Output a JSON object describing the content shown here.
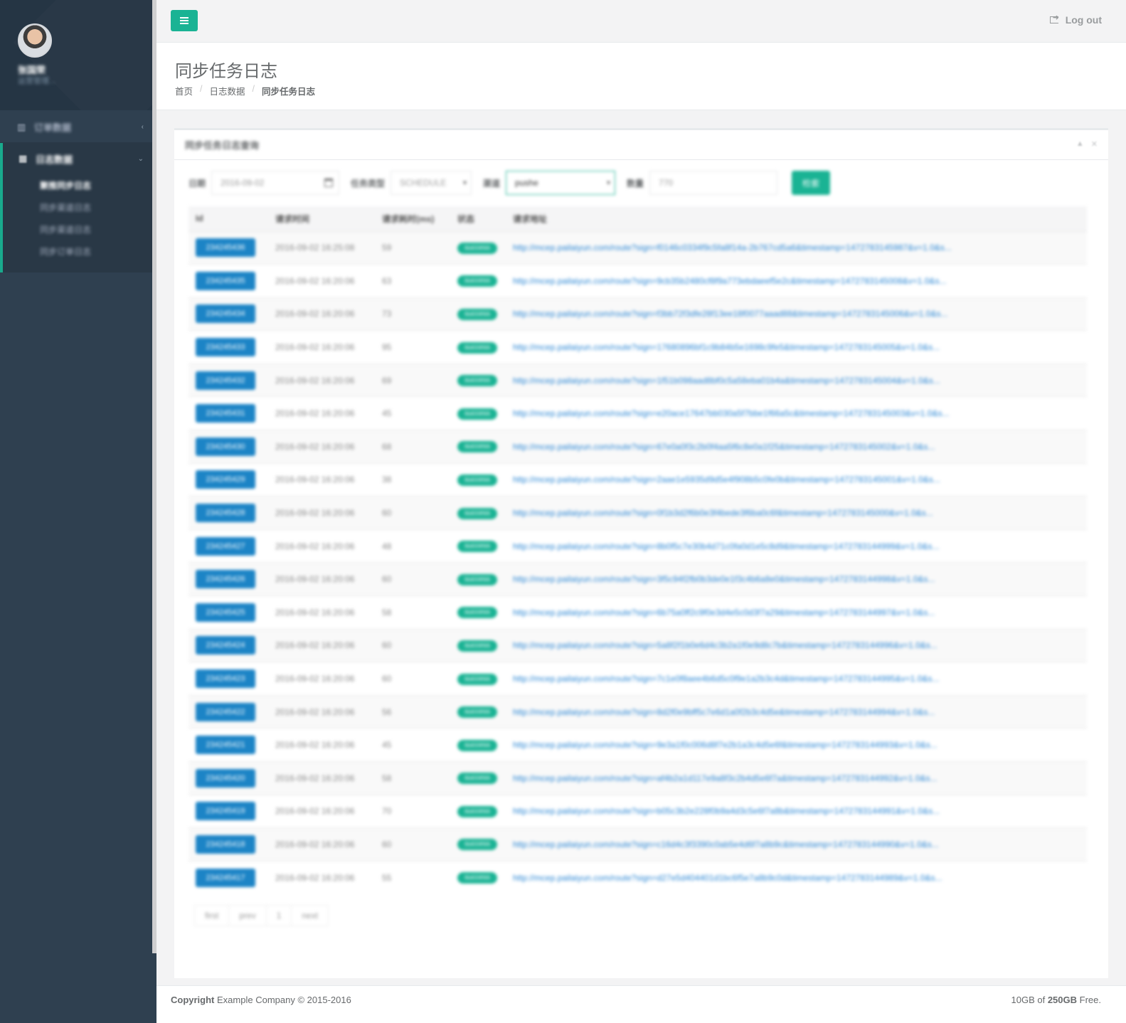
{
  "sidebar": {
    "user": {
      "name": "张国荣",
      "role": "运营管理..."
    },
    "nav": [
      {
        "icon": "bar-chart-icon",
        "label": "订单数据"
      },
      {
        "icon": "table-icon",
        "label": "日志数据"
      }
    ],
    "sub_items": [
      "聚推同步日志",
      "同步渠道日志",
      "同步渠道日志",
      "同步订单日志"
    ]
  },
  "topbar": {
    "logout": "Log out"
  },
  "page": {
    "title": "同步任务日志",
    "breadcrumb": [
      "首页",
      "日志数据",
      "同步任务日志"
    ]
  },
  "panel": {
    "title": "同步任务日志查询",
    "filters": {
      "date_label": "日期",
      "date_value": "2016-09-02",
      "type_label": "任务类型",
      "type_value": "SCHEDULE",
      "channel_label": "渠道",
      "channel_value": "pushe",
      "count_label": "数量",
      "count_value": "770",
      "search_button": "检索"
    },
    "columns": [
      "Id",
      "请求时间",
      "请求耗时(ms)",
      "状态",
      "请求地址"
    ],
    "rows": [
      {
        "id": "234245436",
        "time": "2016-09-02 16:25:08",
        "ms": "59",
        "status": "success",
        "url": "http://mcep.pailaiyun.com/route?sign=f0146c0334f9c5fa8f14a-2b767cd5a6&timestamp=1472783145987&v=1.0&s..."
      },
      {
        "id": "234245435",
        "time": "2016-09-02 16:20:06",
        "ms": "63",
        "status": "success",
        "url": "http://mcep.pailaiyun.com/route?sign=9cb35b2480cf8f9a773ebdaeef5e2c&timestamp=1472783145008&v=1.0&s..."
      },
      {
        "id": "234245434",
        "time": "2016-09-02 16:20:06",
        "ms": "73",
        "status": "success",
        "url": "http://mcep.pailaiyun.com/route?sign=f3bb72f3dfe28f13ee18f0077aaad88&timestamp=1472783145006&v=1.0&s..."
      },
      {
        "id": "234245433",
        "time": "2016-09-02 16:20:06",
        "ms": "95",
        "status": "success",
        "url": "http://mcep.pailaiyun.com/route?sign=17680896bf1c9b84b5e1698c9fe5&timestamp=1472783145005&v=1.0&s..."
      },
      {
        "id": "234245432",
        "time": "2016-09-02 16:20:06",
        "ms": "69",
        "status": "success",
        "url": "http://mcep.pailaiyun.com/route?sign=1f51b098aad8bf0c5a58eba01b4a&timestamp=1472783145004&v=1.0&s..."
      },
      {
        "id": "234245431",
        "time": "2016-09-02 16:20:06",
        "ms": "45",
        "status": "success",
        "url": "http://mcep.pailaiyun.com/route?sign=e20ace17647bb030a5f7bbe1f66a5c&timestamp=1472783145003&v=1.0&s..."
      },
      {
        "id": "234245430",
        "time": "2016-09-02 16:20:06",
        "ms": "68",
        "status": "success",
        "url": "http://mcep.pailaiyun.com/route?sign=67e0a0f3c2b0f4aa5f6c8e0a1f25&timestamp=1472783145002&v=1.0&s..."
      },
      {
        "id": "234245429",
        "time": "2016-09-02 16:20:06",
        "ms": "38",
        "status": "success",
        "url": "http://mcep.pailaiyun.com/route?sign=2aae1e5935d9d5e4f908b5c0fe0b&timestamp=1472783145001&v=1.0&s..."
      },
      {
        "id": "234245428",
        "time": "2016-09-02 16:20:06",
        "ms": "60",
        "status": "success",
        "url": "http://mcep.pailaiyun.com/route?sign=0f1b3d2f6b0e3f4bede3f6ba0c6f&timestamp=1472783145000&v=1.0&s..."
      },
      {
        "id": "234245427",
        "time": "2016-09-02 16:20:06",
        "ms": "48",
        "status": "success",
        "url": "http://mcep.pailaiyun.com/route?sign=8b0f5c7e30b4d71c0fa0d1e5c8d9&timestamp=1472783144999&v=1.0&s..."
      },
      {
        "id": "234245426",
        "time": "2016-09-02 16:20:06",
        "ms": "60",
        "status": "success",
        "url": "http://mcep.pailaiyun.com/route?sign=3f5c94f2fb0b3de0e1f3c4b6a8e0&timestamp=1472783144998&v=1.0&s..."
      },
      {
        "id": "234245425",
        "time": "2016-09-02 16:20:06",
        "ms": "58",
        "status": "success",
        "url": "http://mcep.pailaiyun.com/route?sign=6b75a0ff2c9f0e3d4e5c0d3f7a29&timestamp=1472783144997&v=1.0&s..."
      },
      {
        "id": "234245424",
        "time": "2016-09-02 16:20:06",
        "ms": "60",
        "status": "success",
        "url": "http://mcep.pailaiyun.com/route?sign=5a8f2f1b0e6d4c3b2a1f0e9d8c7b&timestamp=1472783144996&v=1.0&s..."
      },
      {
        "id": "234245423",
        "time": "2016-09-02 16:20:06",
        "ms": "60",
        "status": "success",
        "url": "http://mcep.pailaiyun.com/route?sign=7c1e0f8aee4b6d5c0f9e1a2b3c4d&timestamp=1472783144995&v=1.0&s..."
      },
      {
        "id": "234245422",
        "time": "2016-09-02 16:20:06",
        "ms": "56",
        "status": "success",
        "url": "http://mcep.pailaiyun.com/route?sign=8d2f0e9bff5c7e6d1a0f2b3c4d5e&timestamp=1472783144994&v=1.0&s..."
      },
      {
        "id": "234245421",
        "time": "2016-09-02 16:20:06",
        "ms": "45",
        "status": "success",
        "url": "http://mcep.pailaiyun.com/route?sign=9e3a1f0c006d8f7e2b1a3c4d5e6f&timestamp=1472783144993&v=1.0&s..."
      },
      {
        "id": "234245420",
        "time": "2016-09-02 16:20:06",
        "ms": "58",
        "status": "success",
        "url": "http://mcep.pailaiyun.com/route?sign=af4b2a1d117e9a8f3c2b4d5e6f7a&timestamp=1472783144992&v=1.0&s..."
      },
      {
        "id": "234245419",
        "time": "2016-09-02 16:20:06",
        "ms": "70",
        "status": "success",
        "url": "http://mcep.pailaiyun.com/route?sign=b05c3b2e228f0b9a4d3c5e6f7a8b&timestamp=1472783144991&v=1.0&s..."
      },
      {
        "id": "234245418",
        "time": "2016-09-02 16:20:06",
        "ms": "60",
        "status": "success",
        "url": "http://mcep.pailaiyun.com/route?sign=c16d4c3f3390c0ab5e4d6f7a8b9c&timestamp=1472783144990&v=1.0&s..."
      },
      {
        "id": "234245417",
        "time": "2016-09-02 16:20:06",
        "ms": "55",
        "status": "success",
        "url": "http://mcep.pailaiyun.com/route?sign=d27e5d404401d1bc6f5e7a8b9c0d&timestamp=1472783144989&v=1.0&s..."
      }
    ],
    "pager": [
      "first",
      "prev",
      "1",
      "next"
    ]
  },
  "footer": {
    "copyright_label": "Copyright",
    "copyright_text": "Example Company © 2015-2016",
    "storage_used": "10GB of",
    "storage_total": "250GB",
    "storage_suffix": "Free."
  },
  "colors": {
    "primary": "#1ab394",
    "link": "#1c84c6",
    "sidebar": "#2f4050"
  }
}
